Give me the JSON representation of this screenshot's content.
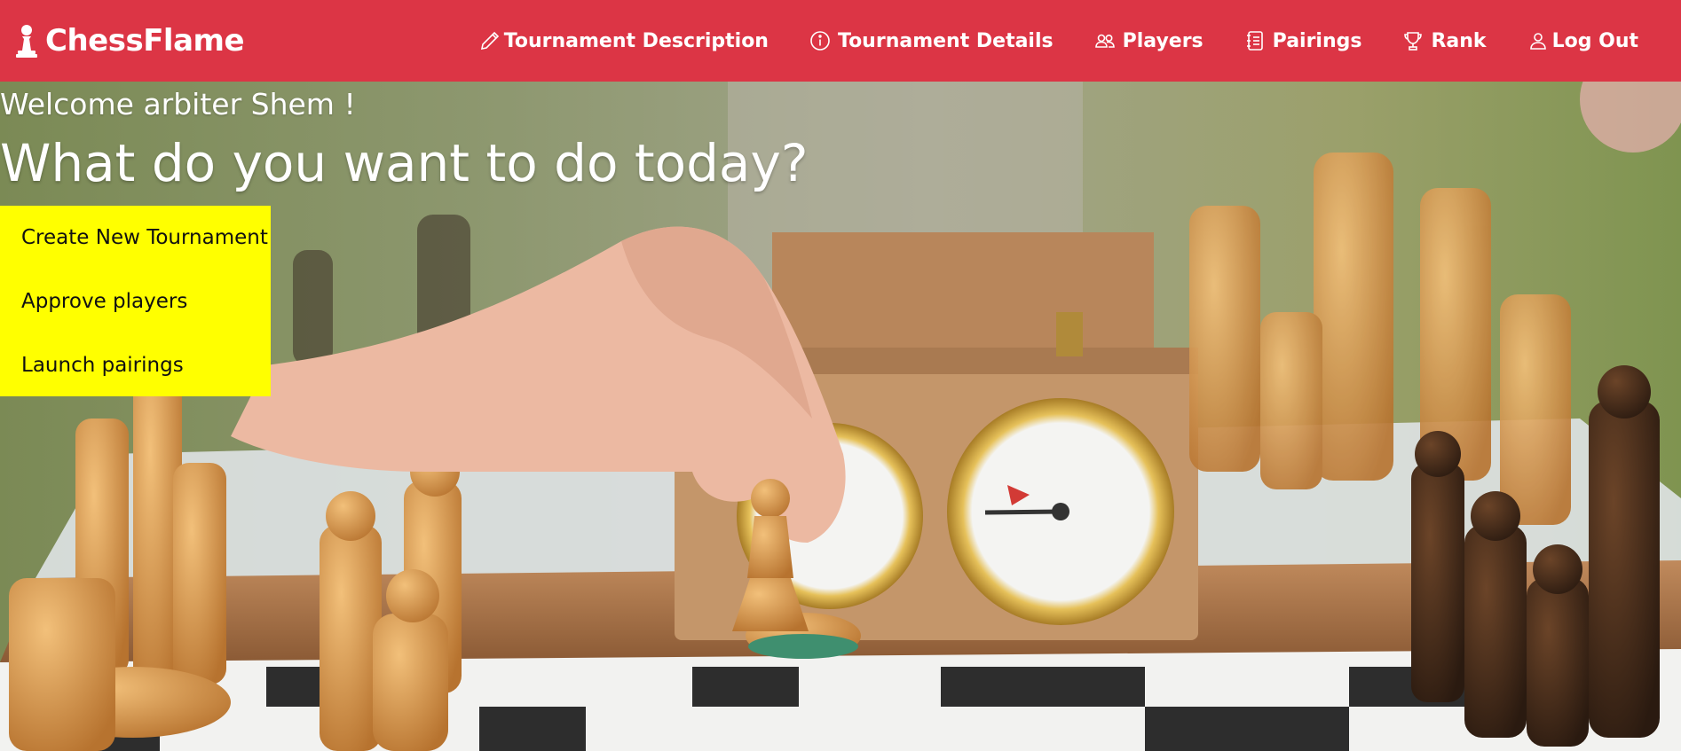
{
  "brand": {
    "name": "ChessFlame",
    "icon": "pawn-icon",
    "color": "#dc3545"
  },
  "nav": {
    "items": [
      {
        "label": "Tournament Description",
        "icon": "pencil-icon"
      },
      {
        "label": "Tournament Details",
        "icon": "info-circle-icon"
      },
      {
        "label": "Players",
        "icon": "people-icon"
      },
      {
        "label": "Pairings",
        "icon": "journal-list-icon"
      },
      {
        "label": "Rank",
        "icon": "trophy-icon"
      },
      {
        "label": "Log Out",
        "icon": "person-icon"
      }
    ]
  },
  "hero": {
    "welcome": "Welcome arbiter Shem !",
    "heading": "What do you want to do today?",
    "image": "chess-board-photo"
  },
  "actions": {
    "background": "#ffff00",
    "items": [
      {
        "label": "Create New Tournament"
      },
      {
        "label": "Approve players"
      },
      {
        "label": "Launch pairings"
      }
    ]
  }
}
